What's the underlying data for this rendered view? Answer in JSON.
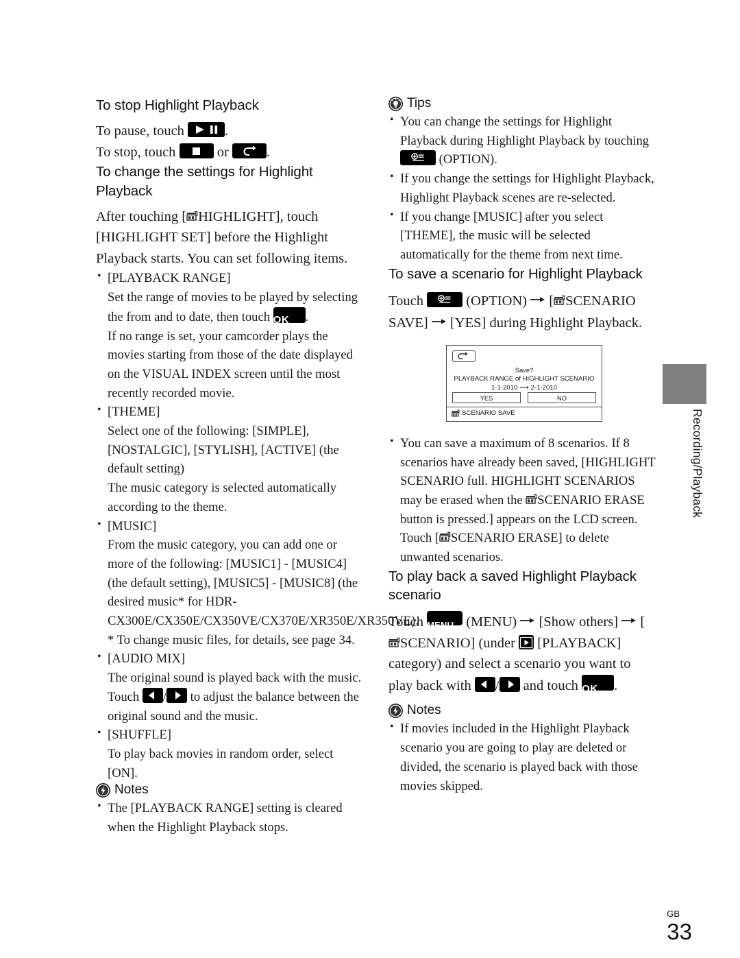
{
  "page": {
    "locale_code": "GB",
    "page_number": "33",
    "side_tab_label": "Recording/Playback"
  },
  "left_column": {
    "section1": {
      "heading": "To stop Highlight Playback",
      "line1_pre": "To pause, touch ",
      "line1_post": ".",
      "line2_pre": "To stop, touch ",
      "line2_mid": " or ",
      "line2_post": "."
    },
    "section2": {
      "heading": "To change the settings for Highlight Playback",
      "intro_pre": "After touching [",
      "intro_mid": "HIGHLIGHT], touch [HIGHLIGHT SET] before the Highlight Playback starts. You can set following items.",
      "items": [
        {
          "title": "[PLAYBACK RANGE]",
          "body_a_pre": "Set the range of movies to be played by selecting the from and to date, then touch ",
          "body_a_post": ".",
          "body_b": "If no range is set, your camcorder plays the movies starting from those of the date displayed on the VISUAL INDEX screen until the most recently recorded movie."
        },
        {
          "title": "[THEME]",
          "body_a": "Select one of the following: [SIMPLE], [NOSTALGIC], [STYLISH], [ACTIVE] (the default setting)",
          "body_b": "The music category is selected automatically according to the theme."
        },
        {
          "title": "[MUSIC]",
          "body_a": "From the music category, you can add one or more of the following: [MUSIC1] - [MUSIC4] (the default setting), [MUSIC5] - [MUSIC8] (the desired music* for HDR-CX300E/CX350E/CX350VE/CX370E/XR350E/XR350VE).",
          "footnote": "* To change music files, for details, see page 34."
        },
        {
          "title": "[AUDIO MIX]",
          "body_a": "The original sound is played back with the music.",
          "body_b_pre": "Touch ",
          "body_b_mid": "/",
          "body_b_post": " to adjust the balance between the original sound and the music."
        },
        {
          "title": "[SHUFFLE]",
          "body_a": "To play back movies in random order, select [ON]."
        }
      ]
    },
    "notes": {
      "label": "Notes",
      "icon": "lightning-circle-icon",
      "items": [
        "The [PLAYBACK RANGE] setting is cleared when the Highlight Playback stops."
      ]
    }
  },
  "right_column": {
    "tips": {
      "label": "Tips",
      "icon": "lightbulb-circle-icon",
      "items": [
        {
          "pre": "You can change the settings for Highlight Playback during Highlight Playback by touching ",
          "post": " (OPTION)."
        },
        {
          "pre": "If you change the settings for Highlight Playback, Highlight Playback scenes are re-selected.",
          "post": ""
        },
        {
          "pre": "If you change [MUSIC] after you select [THEME], the music will be selected automatically for the theme from next time.",
          "post": ""
        }
      ]
    },
    "section_save": {
      "heading": "To save a scenario for Highlight Playback",
      "step_pre": "Touch ",
      "step_a": " (OPTION) ",
      "step_b_pre": " [",
      "step_b_post": "SCENARIO SAVE] ",
      "step_c": " [YES] during Highlight Playback.",
      "lcd": {
        "back_icon": "back-arrow-icon",
        "msg_line1": "Save?",
        "msg_line2": "PLAYBACK RANGE of HIGHLIGHT SCENARIO",
        "msg_line3_from": "1-1-2010",
        "msg_line3_to": "2-1-2010",
        "btn_yes": "YES",
        "btn_no": "NO",
        "footer_label": "SCENARIO SAVE"
      },
      "bullets": [
        {
          "l1": "You can save a maximum of 8 scenarios. If 8 scenarios have already been saved, [HIGHLIGHT SCENARIO full. HIGHLIGHT SCENARIOS may be erased when the ",
          "l2": "SCENARIO ERASE button is pressed.] appears on the LCD screen. Touch [",
          "l3": "SCENARIO ERASE] to delete unwanted scenarios."
        }
      ]
    },
    "section_play": {
      "heading": "To play back a saved Highlight Playback scenario",
      "step_pre": "Touch ",
      "step_a": " (MENU) ",
      "step_b": " [Show others] ",
      "step_c_pre": " [",
      "step_c_post": "SCENARIO] (under ",
      "step_d": " [PLAYBACK] category) and select a scenario you want to play back with ",
      "step_e_mid": "/",
      "step_f": " and touch ",
      "step_g": "."
    },
    "notes": {
      "label": "Notes",
      "icon": "lightning-circle-icon",
      "items": [
        "If movies included in the Highlight Playback scenario you are going to play are deleted or divided, the scenario is played back with those movies skipped."
      ]
    }
  },
  "icons": {
    "play_pause": "play-pause-button-icon",
    "stop": "stop-button-icon",
    "back": "back-button-icon",
    "ok": "OK",
    "menu": "MENU",
    "option": "option-button-icon",
    "prev": "prev-arrow-button-icon",
    "next": "next-arrow-button-icon",
    "playback": "playback-category-icon",
    "highlight": "highlight-scenario-glyph-icon"
  },
  "colors": {
    "text": "#1a1a1a",
    "button_fill": "#000000",
    "side_tab": "#808080",
    "lcd_border": "#4a4a4a"
  }
}
